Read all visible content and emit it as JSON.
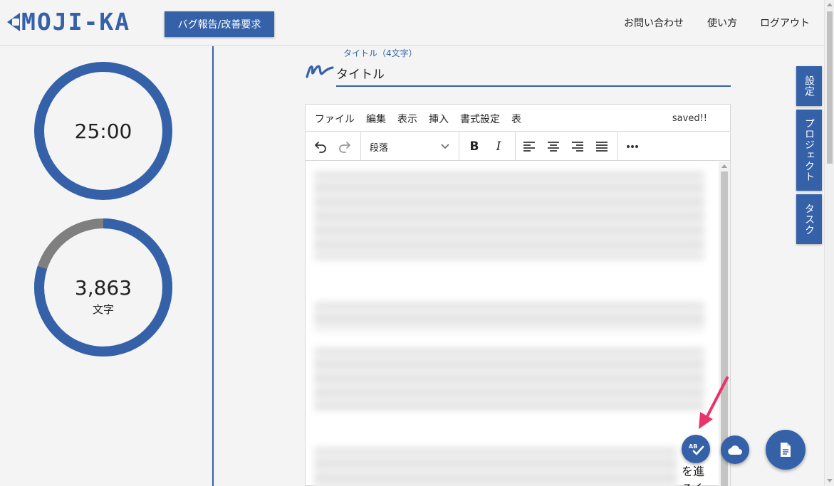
{
  "app": {
    "logo_text": "MOJI-KA",
    "bug_button": "バグ報告/改善要求",
    "nav": {
      "contact": "お問い合わせ",
      "howto": "使い方",
      "logout": "ログアウト"
    }
  },
  "stats": {
    "timer": {
      "text": "25:00",
      "progress": 1.0
    },
    "char_count": {
      "number": "3,863",
      "unit": "文字",
      "progress": 0.8
    }
  },
  "title_field": {
    "label": "タイトル（4文字）",
    "value": "タイトル"
  },
  "editor": {
    "menu": [
      "ファイル",
      "編集",
      "表示",
      "挿入",
      "書式設定",
      "表"
    ],
    "status": "saved!!",
    "format_select": "段落",
    "visible_text": [
      "を進",
      "ろく"
    ]
  },
  "side_tabs": {
    "settings": "設定",
    "project": "プロジェクト",
    "task": "タスク"
  },
  "icons": {
    "undo": "undo-icon",
    "redo": "redo-icon",
    "bold": "B",
    "italic": "I",
    "align_left": "align-left-icon",
    "align_center": "align-center-icon",
    "align_right": "align-right-icon",
    "align_justify": "align-justify-icon",
    "more": "more-icon",
    "spellcheck": "spellcheck-icon",
    "cloud": "cloud-icon",
    "document": "document-icon",
    "title_glyph": "pen-stroke-icon"
  },
  "colors": {
    "accent": "#3561a8",
    "ring_track": "#7f7f7f",
    "arrow": "#e8336b"
  }
}
